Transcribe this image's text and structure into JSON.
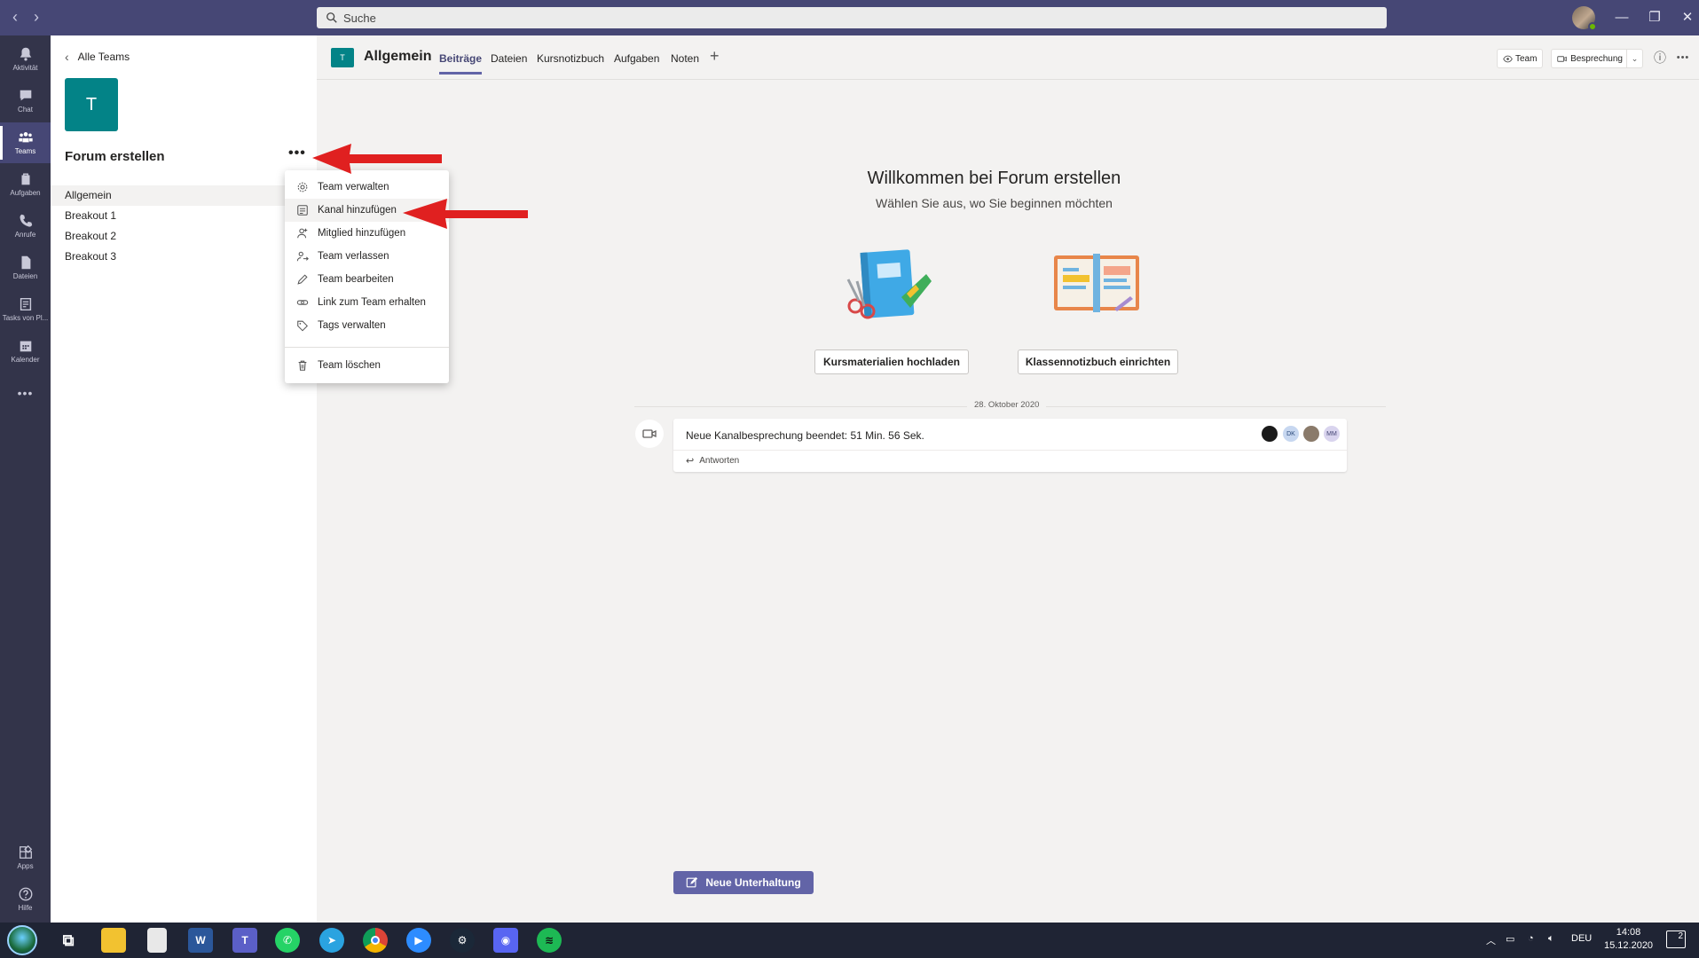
{
  "titlebar": {
    "search_placeholder": "Suche",
    "back": "‹",
    "forward": "›",
    "minimize": "—",
    "maximize": "❐",
    "close": "✕"
  },
  "appbar": {
    "items": [
      {
        "label": "Aktivität",
        "icon": "bell-icon"
      },
      {
        "label": "Chat",
        "icon": "chat-icon"
      },
      {
        "label": "Teams",
        "icon": "teams-icon",
        "active": true
      },
      {
        "label": "Aufgaben",
        "icon": "assignments-icon"
      },
      {
        "label": "Anrufe",
        "icon": "phone-icon"
      },
      {
        "label": "Dateien",
        "icon": "file-icon"
      },
      {
        "label": "Tasks von Pl...",
        "icon": "tasks-icon"
      },
      {
        "label": "Kalender",
        "icon": "calendar-icon"
      }
    ],
    "more": "•••",
    "apps_label": "Apps",
    "help_label": "Hilfe"
  },
  "teampanel": {
    "back_label": "Alle Teams",
    "avatar_letter": "T",
    "team_name": "Forum erstellen",
    "more": "•••",
    "channels": [
      "Allgemein",
      "Breakout 1",
      "Breakout 2",
      "Breakout 3"
    ]
  },
  "menu": {
    "items": [
      {
        "label": "Team verwalten",
        "icon": "gear-icon"
      },
      {
        "label": "Kanal hinzufügen",
        "icon": "channel-add-icon"
      },
      {
        "label": "Mitglied hinzufügen",
        "icon": "add-member-icon"
      },
      {
        "label": "Team verlassen",
        "icon": "leave-icon"
      },
      {
        "label": "Team bearbeiten",
        "icon": "pencil-icon"
      },
      {
        "label": "Link zum Team erhalten",
        "icon": "link-icon"
      },
      {
        "label": "Tags verwalten",
        "icon": "tag-icon"
      },
      {
        "label": "Team löschen",
        "icon": "trash-icon"
      }
    ]
  },
  "channel_header": {
    "avatar_letter": "T",
    "title": "Allgemein",
    "tabs": [
      "Beiträge",
      "Dateien",
      "Kursnotizbuch",
      "Aufgaben",
      "Noten"
    ],
    "add_tab": "+",
    "team_button": "Team",
    "meeting_button": "Besprechung",
    "info": "ⓘ",
    "more": "•••"
  },
  "welcome": {
    "title": "Willkommen bei Forum erstellen",
    "subtitle": "Wählen Sie aus, wo Sie beginnen möchten",
    "button_left": "Kursmaterialien hochladen",
    "button_right": "Klassennotizbuch einrichten"
  },
  "feed": {
    "date": "28. Oktober 2020",
    "post_text": "Neue Kanalbesprechung beendet: 51 Min. 56 Sek.",
    "reply": "Antworten",
    "participants": [
      {
        "initials": "",
        "color": "#1a1a1a"
      },
      {
        "initials": "DK",
        "color": "#c7d7f0"
      },
      {
        "initials": "",
        "color": "#8a7a6a"
      },
      {
        "initials": "MM",
        "color": "#d9d4ee"
      }
    ]
  },
  "new_conversation": "Neue Unterhaltung",
  "taskbar": {
    "lang": "DEU",
    "time": "14:08",
    "date": "15.12.2020",
    "notifications": "2",
    "apps": [
      {
        "name": "task-view-icon",
        "color": "#1f2434",
        "glyph": "⧉"
      },
      {
        "name": "file-explorer-icon",
        "color": "#f2c230",
        "glyph": ""
      },
      {
        "name": "notepad-icon",
        "color": "#e8e8e8",
        "glyph": ""
      },
      {
        "name": "word-icon",
        "color": "#2b579a",
        "glyph": "W"
      },
      {
        "name": "teams-taskbar-icon",
        "color": "#5b5fc7",
        "glyph": "T"
      },
      {
        "name": "whatsapp-icon",
        "color": "#25d366",
        "glyph": "✆"
      },
      {
        "name": "telegram-icon",
        "color": "#2aa3e0",
        "glyph": "➤"
      },
      {
        "name": "chrome-icon",
        "color": "#db4437",
        "glyph": "●"
      },
      {
        "name": "zoom-icon",
        "color": "#2d8cff",
        "glyph": "▶"
      },
      {
        "name": "steam-icon",
        "color": "#1b2838",
        "glyph": "⚙"
      },
      {
        "name": "discord-icon",
        "color": "#5865f2",
        "glyph": "◉"
      },
      {
        "name": "spotify-icon",
        "color": "#1db954",
        "glyph": "≋"
      }
    ]
  },
  "colors": {
    "titlebar": "#464775",
    "appbar": "#33344a",
    "accent": "#6264a7",
    "team_avatar": "#038387",
    "annotation_arrow": "#e02020"
  }
}
